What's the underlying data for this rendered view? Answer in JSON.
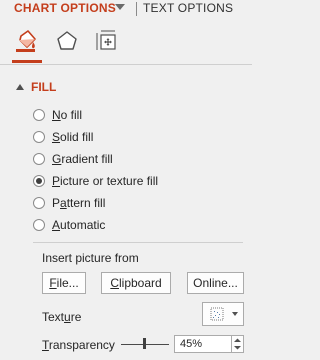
{
  "header": {
    "chart_options": "CHART OPTIONS",
    "text_options": "TEXT OPTIONS"
  },
  "icon_tabs": [
    "fill-line-icon",
    "effects-icon",
    "size-properties-icon"
  ],
  "fill": {
    "title": "FILL",
    "options": [
      {
        "pre": "",
        "ul": "N",
        "post": "o fill",
        "checked": false
      },
      {
        "pre": "",
        "ul": "S",
        "post": "olid fill",
        "checked": false
      },
      {
        "pre": "",
        "ul": "G",
        "post": "radient fill",
        "checked": false
      },
      {
        "pre": "",
        "ul": "P",
        "post": "icture or texture fill",
        "checked": true
      },
      {
        "pre": "P",
        "ul": "a",
        "post": "ttern fill",
        "checked": false
      },
      {
        "pre": "",
        "ul": "A",
        "post": "utomatic",
        "checked": false
      }
    ],
    "insert_picture_from": "Insert picture from",
    "buttons": {
      "file": {
        "ul": "F",
        "post": "ile..."
      },
      "clipboard": {
        "ul": "C",
        "post": "lipboard"
      },
      "online": {
        "ul": "",
        "post": "Online..."
      }
    },
    "texture": {
      "pre": "Text",
      "ul": "u",
      "post": "re"
    },
    "transparency": {
      "ul": "T",
      "post": "ransparency"
    },
    "transparency_value": "45%",
    "transparency_level": 0.45
  },
  "colors": {
    "accent": "#c43e1c"
  }
}
